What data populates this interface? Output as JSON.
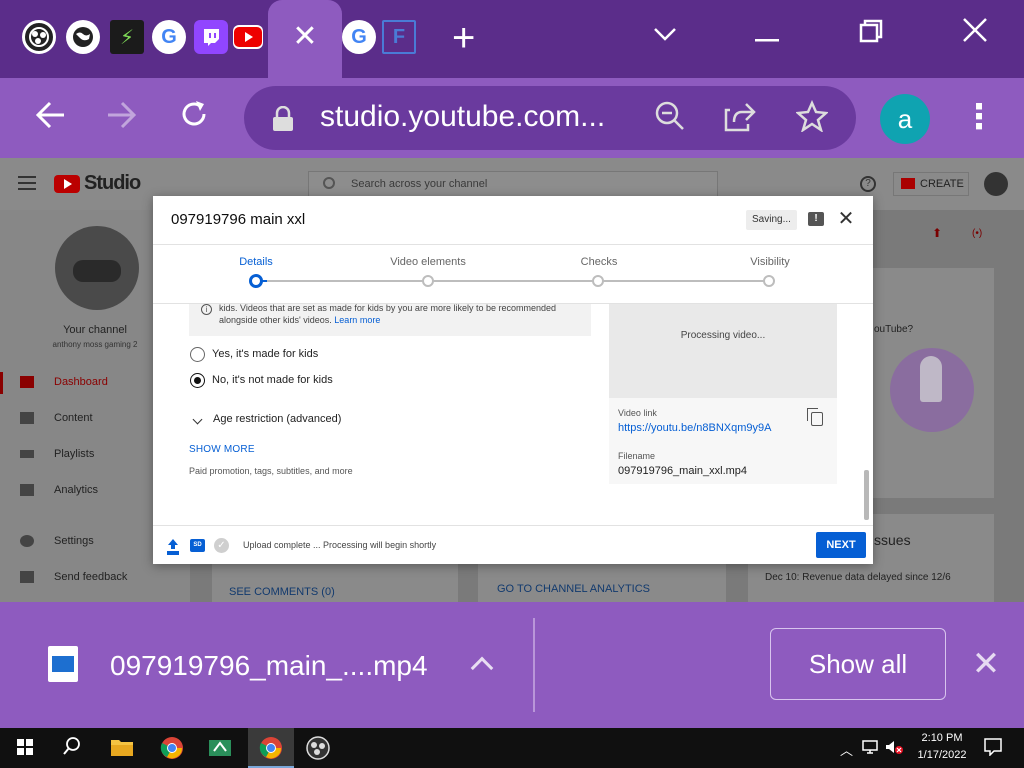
{
  "browser": {
    "tabs": [
      {
        "icon": "obs-icon",
        "glyph": ""
      },
      {
        "icon": "globe-icon",
        "glyph": ""
      },
      {
        "icon": "lightning-icon",
        "glyph": "⚡"
      },
      {
        "icon": "google-icon",
        "glyph": "G"
      },
      {
        "icon": "twitch-icon",
        "glyph": ""
      },
      {
        "icon": "youtube-icon",
        "glyph": ""
      },
      {
        "icon": "google-icon",
        "glyph": "G"
      },
      {
        "icon": "f-logo-icon",
        "glyph": "F"
      }
    ],
    "active_tab_close": "✕",
    "new_tab": "+",
    "url": "studio.youtube.com...",
    "profile_initial": "a"
  },
  "studio": {
    "brand": "Studio",
    "search_placeholder": "Search across your channel",
    "create_label": "CREATE",
    "your_channel": "Your channel",
    "channel_name": "anthony moss gaming 2",
    "nav": [
      {
        "label": "Dashboard",
        "active": true
      },
      {
        "label": "Content"
      },
      {
        "label": "Playlists"
      },
      {
        "label": "Analytics"
      },
      {
        "label": "Settings"
      },
      {
        "label": "Send feedback"
      }
    ],
    "bg_youtube_q": "ouTube?",
    "bg_issues": "ssues",
    "bg_revenue": "Dec 10: Revenue data delayed since 12/6",
    "bg_see_comments": "SEE COMMENTS (0)",
    "bg_channel_analytics": "GO TO CHANNEL ANALYTICS"
  },
  "modal": {
    "title": "097919796 main xxl",
    "saving": "Saving...",
    "steps": [
      "Details",
      "Video elements",
      "Checks",
      "Visibility"
    ],
    "info_line1": "kids. Videos that are set as made for kids by you are more likely to be recommended",
    "info_line2": "alongside other kids' videos. ",
    "info_link": "Learn more",
    "radio_yes": "Yes, it's made for kids",
    "radio_no": "No, it's not made for kids",
    "age_restriction": "Age restriction (advanced)",
    "show_more": "SHOW MORE",
    "show_more_sub": "Paid promotion, tags, subtitles, and more",
    "processing": "Processing video...",
    "video_link_label": "Video link",
    "video_link": "https://youtu.be/n8BNXqm9y9A",
    "filename_label": "Filename",
    "filename": "097919796_main_xxl.mp4",
    "sd_badge": "SD",
    "upload_status": "Upload complete ... Processing will begin shortly",
    "next": "NEXT"
  },
  "download": {
    "filename": "097919796_main_....mp4",
    "show_all": "Show all"
  },
  "taskbar": {
    "time": "2:10 PM",
    "date": "1/17/2022"
  }
}
